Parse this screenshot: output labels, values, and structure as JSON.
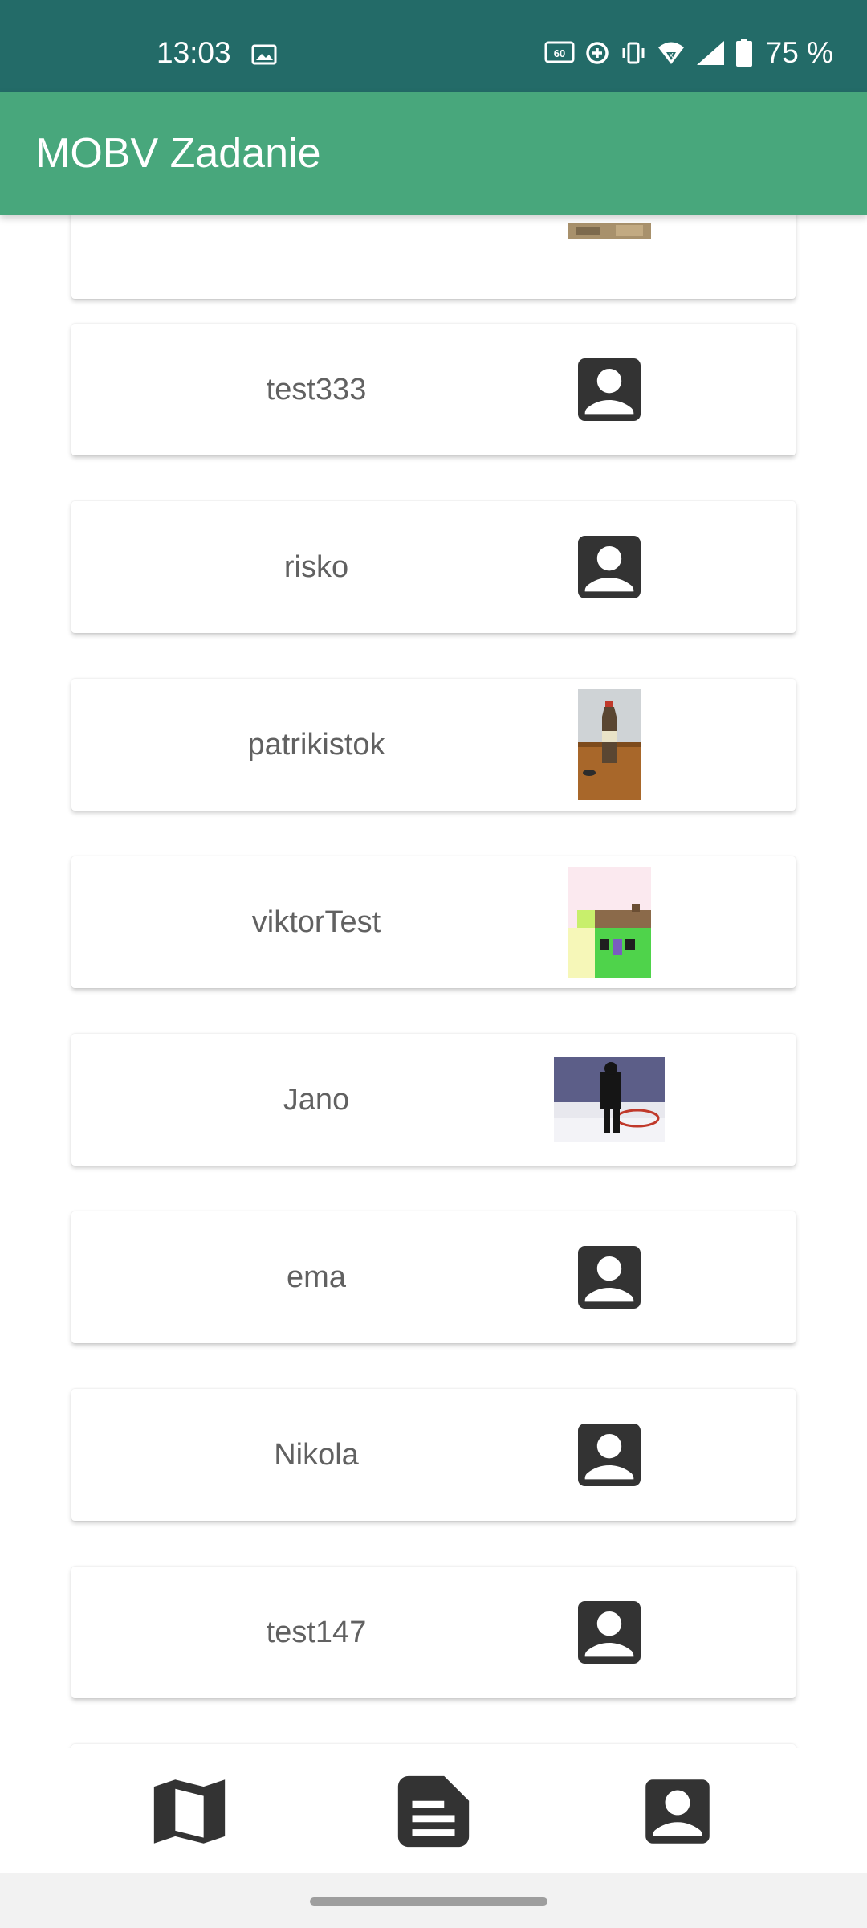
{
  "status_bar": {
    "time": "13:03",
    "battery_text": "75 %",
    "icons": [
      "gallery-icon",
      "60hz-icon",
      "data-saver-icon",
      "vibrate-icon",
      "wifi-icon",
      "signal-icon",
      "battery-icon"
    ]
  },
  "app_bar": {
    "title": "MOBV Zadanie"
  },
  "users": [
    {
      "name": "test333",
      "thumbnail": "default-avatar-icon"
    },
    {
      "name": "risko",
      "thumbnail": "default-avatar-icon"
    },
    {
      "name": "patrikistok",
      "thumbnail": "bottle-photo"
    },
    {
      "name": "viktorTest",
      "thumbnail": "pixel-art-photo"
    },
    {
      "name": "Jano",
      "thumbnail": "hockey-photo"
    },
    {
      "name": "ema",
      "thumbnail": "default-avatar-icon"
    },
    {
      "name": "Nikola",
      "thumbnail": "default-avatar-icon"
    },
    {
      "name": "test147",
      "thumbnail": "default-avatar-icon"
    }
  ],
  "bottom_nav": {
    "items": [
      {
        "icon": "map-icon"
      },
      {
        "icon": "feed-icon"
      },
      {
        "icon": "profile-icon"
      }
    ]
  },
  "colors": {
    "status_bar": "#236b68",
    "app_bar": "#48a77c",
    "icon": "#333333",
    "text": "#616161"
  }
}
